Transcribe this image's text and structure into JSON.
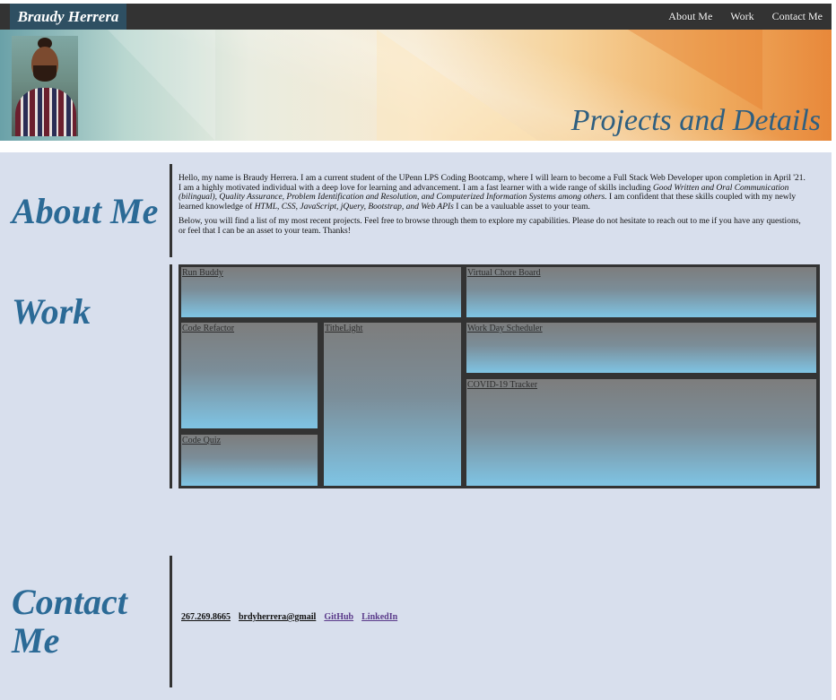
{
  "header": {
    "brand": "Braudy Herrera",
    "nav": [
      "About Me",
      "Work",
      "Contact Me"
    ],
    "hero_title": "Projects and Details"
  },
  "about": {
    "heading": "About Me",
    "p1_a": "Hello, my name is Braudy Herrera. I am a current student of the UPenn LPS Coding Bootcamp, where I will learn to become a Full Stack Web Developer upon completion in April '21. I am a highly motivated individual with a deep love for learning and advancement. I am a fast learner with a wide range of skills including ",
    "p1_skills": "Good Written and Oral Communication (bilingual), Quality Assurance, Problem Identification and Resolution, and Computerized Information Systems among others.",
    "p1_b": " I am confident that these skills coupled with my newly learned knowledge of ",
    "p1_tech": "HTML, CSS, JavaScript, jQuery, Bootstrap, and Web APIs",
    "p1_c": " I can be a vauluable asset to your team.",
    "p2": "Below, you will find a list of my most recent projects. Feel free to browse through them to explore my capabilities. Please do not hesitate to reach out to me if you have any questions, or feel that I can be an asset to your team. Thanks!"
  },
  "work": {
    "heading": "Work",
    "projects": [
      "Run Buddy",
      "Virtual Chore Board",
      "Code Refactor",
      "TitheLight",
      "Work Day Scheduler",
      "COVID-19 Tracker",
      "Code Quiz"
    ]
  },
  "contact": {
    "heading_line1": "Contact",
    "heading_line2": "Me",
    "phone": "267.269.8665",
    "email": "brdyherrera@gmail",
    "github": "GitHub",
    "linkedin": "LinkedIn"
  },
  "colors": {
    "nav_bg": "#333333",
    "brand_bg": "#2e4f62",
    "heading": "#2b6a96",
    "main_bg": "#d8dfed",
    "link_visited": "#5a3a8a"
  }
}
